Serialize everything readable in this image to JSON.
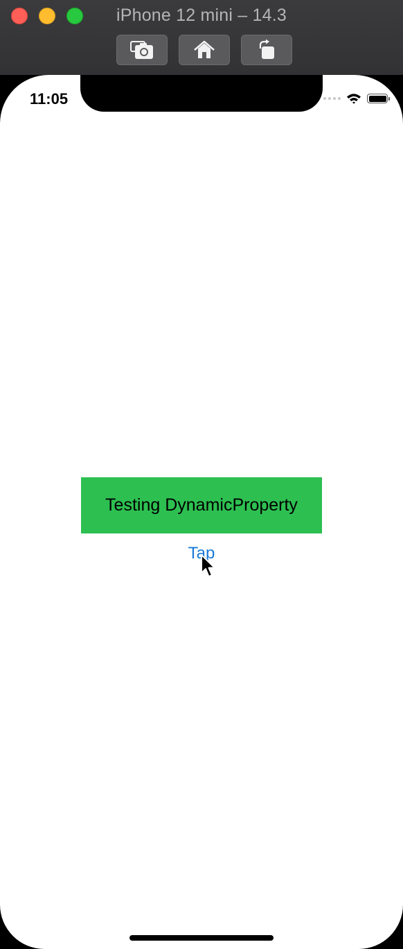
{
  "window": {
    "title": "iPhone 12 mini – 14.3",
    "toolbar": {
      "screenshot_icon": "camera-icon",
      "home_icon": "home-icon",
      "rotate_icon": "rotate-icon"
    }
  },
  "status_bar": {
    "time": "11:05",
    "wifi_icon": "wifi-icon",
    "battery_icon": "battery-icon"
  },
  "content": {
    "label_text": "Testing DynamicProperty",
    "button_label": "Tap"
  },
  "colors": {
    "label_background": "#2dc051",
    "link": "#1a7ad9"
  }
}
